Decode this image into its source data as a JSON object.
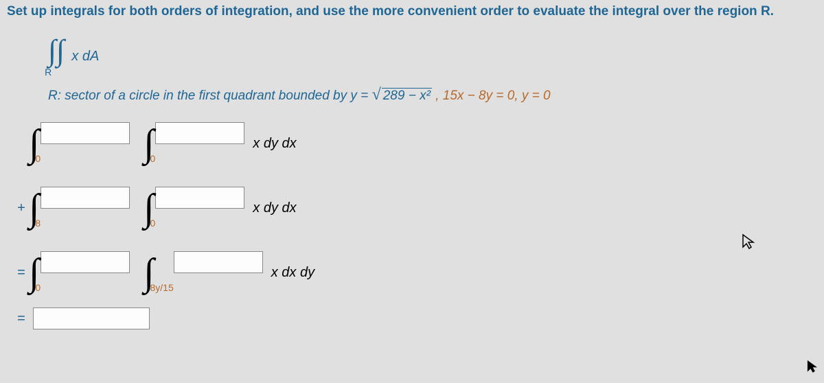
{
  "prompt": "Set up integrals for both orders of integration, and use the more convenient order to evaluate the integral over the region R.",
  "integral": {
    "symbol": "∫∫",
    "sub": "R",
    "integrand": "x dA"
  },
  "region": {
    "prefix": "R: sector of a circle in the first quadrant bounded by y = ",
    "radicand": "289 − x²",
    "suffix": ", 15x − 8y = 0, y = 0"
  },
  "rows": [
    {
      "op": "",
      "lower1": "0",
      "lower2": "0",
      "tail": "x dy dx"
    },
    {
      "op": "+",
      "lower1": "8",
      "lower2": "0",
      "tail": "x dy dx"
    },
    {
      "op": "=",
      "lower1": "0",
      "lower2": "8y/15",
      "tail": "x dx dy"
    }
  ],
  "final_op": "=",
  "cursor_label": "cursor"
}
